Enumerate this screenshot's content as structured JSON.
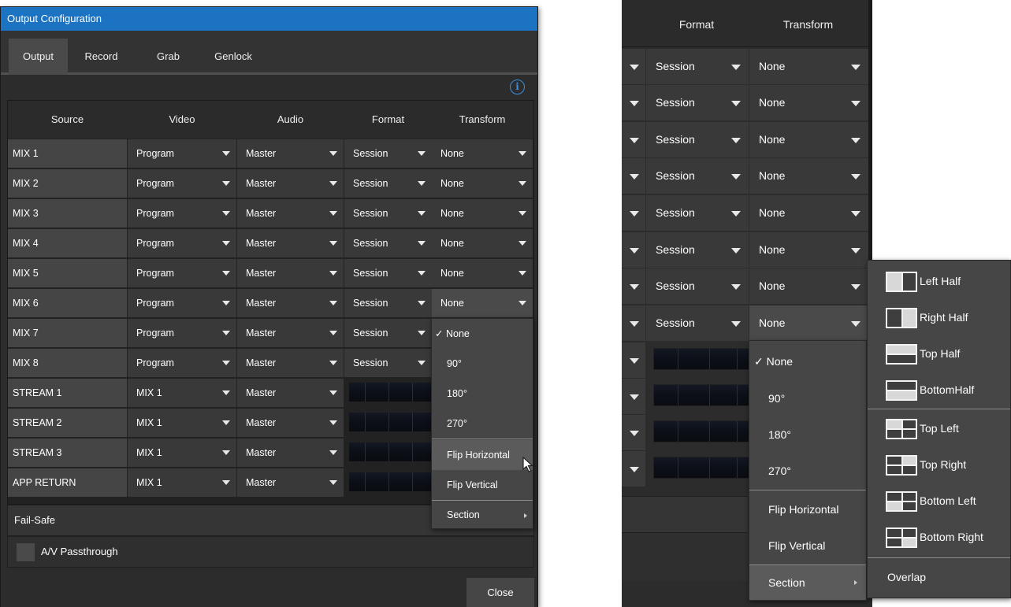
{
  "dialog": {
    "title": "Output Configuration",
    "tabs": [
      "Output",
      "Record",
      "Grab",
      "Genlock"
    ],
    "active_tab": "Output",
    "info_icon": "i",
    "columns": [
      "Source",
      "Video",
      "Audio",
      "Format",
      "Transform"
    ],
    "rows": [
      {
        "source": "MIX 1",
        "video": "Program",
        "audio": "Master",
        "format": "Session",
        "transform": "None"
      },
      {
        "source": "MIX 2",
        "video": "Program",
        "audio": "Master",
        "format": "Session",
        "transform": "None"
      },
      {
        "source": "MIX 3",
        "video": "Program",
        "audio": "Master",
        "format": "Session",
        "transform": "None"
      },
      {
        "source": "MIX 4",
        "video": "Program",
        "audio": "Master",
        "format": "Session",
        "transform": "None"
      },
      {
        "source": "MIX 5",
        "video": "Program",
        "audio": "Master",
        "format": "Session",
        "transform": "None"
      },
      {
        "source": "MIX 6",
        "video": "Program",
        "audio": "Master",
        "format": "Session",
        "transform": "None"
      },
      {
        "source": "MIX 7",
        "video": "Program",
        "audio": "Master",
        "format": "Session"
      },
      {
        "source": "MIX 8",
        "video": "Program",
        "audio": "Master",
        "format": "Session"
      },
      {
        "source": "STREAM 1",
        "video": "MIX 1",
        "audio": "Master"
      },
      {
        "source": "STREAM 2",
        "video": "MIX 1",
        "audio": "Master"
      },
      {
        "source": "STREAM 3",
        "video": "MIX 1",
        "audio": "Master"
      },
      {
        "source": "APP RETURN",
        "video": "MIX 1",
        "audio": "Master"
      }
    ],
    "transform_menu": {
      "items": [
        "None",
        "90°",
        "180°",
        "270°",
        "Flip Horizontal",
        "Flip Vertical",
        "Section"
      ],
      "checked": "None",
      "check_mark": "✓",
      "highlighted": "Flip Horizontal"
    },
    "failsafe_label": "Fail-Safe",
    "av_passthrough_label": "A/V Passthrough",
    "close_label": "Close"
  },
  "zoom": {
    "columns": [
      "Format",
      "Transform"
    ],
    "rows": [
      {
        "format": "Session",
        "transform": "None"
      },
      {
        "format": "Session",
        "transform": "None"
      },
      {
        "format": "Session",
        "transform": "None"
      },
      {
        "format": "Session",
        "transform": "None"
      },
      {
        "format": "Session",
        "transform": "None"
      },
      {
        "format": "Session",
        "transform": "None"
      },
      {
        "format": "Session",
        "transform": "None"
      },
      {
        "format": "Session",
        "transform": "None"
      }
    ],
    "transform_menu": {
      "items": [
        "None",
        "90°",
        "180°",
        "270°",
        "Flip Horizontal",
        "Flip Vertical",
        "Section"
      ],
      "checked": "None",
      "check_mark": "✓",
      "highlighted": "Section"
    },
    "section_submenu": {
      "items": [
        "Left Half",
        "Right Half",
        "Top Half",
        "BottomHalf",
        "Top Left",
        "Top Right",
        "Bottom Left",
        "Bottom Right",
        "Overlap"
      ]
    }
  },
  "colors": {
    "title_bar": "#1b73c2",
    "panel_bg": "#2c2c2c",
    "menu_bg": "#464646",
    "menu_highlight": "#5b5b5b",
    "info_accent": "#3a8fe0"
  }
}
